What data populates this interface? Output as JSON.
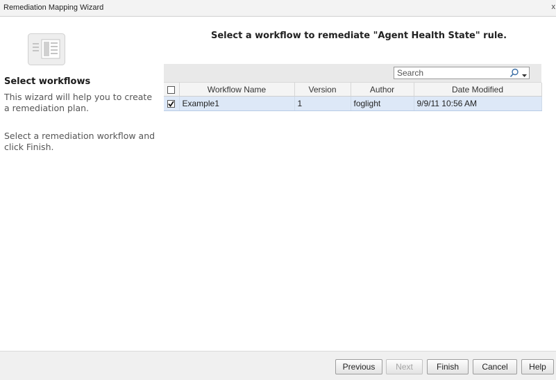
{
  "window": {
    "title": "Remediation Mapping Wizard",
    "close_glyph": "x"
  },
  "sidebar": {
    "icon": "wizard-list-icon",
    "heading": "Select workflows",
    "description": "This wizard will help you to create a remediation plan.",
    "instructions": "Select a remediation workflow and click Finish."
  },
  "main": {
    "title": "Select a workflow to remediate \"Agent Health State\" rule.",
    "search": {
      "placeholder": "Search",
      "icon": "search-icon"
    },
    "table": {
      "columns": [
        "Workflow Name",
        "Version",
        "Author",
        "Date Modified"
      ],
      "rows": [
        {
          "checked": true,
          "name": "Example1",
          "version": "1",
          "author": "foglight",
          "date_modified": "9/9/11 10:56 AM"
        }
      ]
    }
  },
  "footer": {
    "previous": "Previous",
    "next": "Next",
    "finish": "Finish",
    "cancel": "Cancel",
    "help": "Help"
  }
}
